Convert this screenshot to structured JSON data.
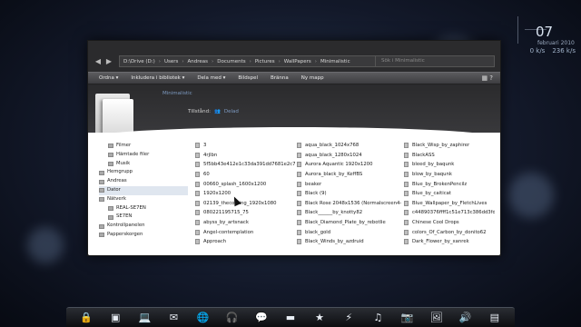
{
  "widgets": {
    "clock_day": "07",
    "clock_month": "februari 2010",
    "net_up": "0 k/s",
    "net_down": "236 k/s"
  },
  "window": {
    "address": [
      "D:\\Drive (D:)",
      "Users",
      "Andreas",
      "Documents",
      "Pictures",
      "WallPapers",
      "Minimalistic"
    ],
    "search_placeholder": "Sök i Minimalistic",
    "toolbar": [
      "Ordna ▾",
      "Inkludera i bibliotek ▾",
      "Dela med ▾",
      "Bildspel",
      "Bränna",
      "Ny mapp"
    ],
    "preview": {
      "name": "Minimalistic",
      "state_label": "Tillstånd:",
      "state_value": "Delad"
    },
    "nav": [
      "Filmer",
      "Hämtade filer",
      "Musik",
      "Hemgrupp",
      "Andreas",
      "Dator",
      "Nätverk",
      "REAL-SE7EN",
      "SE7EN",
      "Kontrollpanelen",
      "Papperskorgen"
    ],
    "files_col1": [
      "3",
      "4rjlbn",
      "5f5bb43e412e1c33da391dd7681e2c7",
      "60",
      "00660_splash_1600x1200",
      "1920x1200",
      "02139_thecoming_1920x1080",
      "080221195715_75",
      "abyss_by_artsnack",
      "Angel-contemplation",
      "Approach"
    ],
    "files_col2": [
      "aqua_black_1024x768",
      "aqua_black_1280x1024",
      "Aurora Aquantic 1920x1200",
      "Aurora_black_by_KeffBS",
      "beaker",
      "Black (9)",
      "Black Rose 2048x1536 (Normalscreen4-3)",
      "Black______by_knotty82",
      "Black_Diamond_Plate_by_rebotlie",
      "black_gold",
      "Black_Winds_by_azdruid"
    ],
    "files_col3": [
      "Black_Wisp_by_zaphirer",
      "BlackASS",
      "bleed_by_baqunk",
      "blow_by_baqunk",
      "Blue_by_BrokenPencilz",
      "Blue_by_caiticat",
      "Blue_Wallpaper_by_FletchLives",
      "c44890376ffff1c51e713c386dd3fde8",
      "Chinese Cool Drops",
      "colors_Of_Carbon_by_donito62",
      "Dark_Flower_by_xanrek"
    ]
  },
  "taskbar": [
    {
      "icon": "lock-icon",
      "glyph": "🔒"
    },
    {
      "icon": "drive-icon",
      "glyph": "▣"
    },
    {
      "icon": "laptop-icon",
      "glyph": "💻"
    },
    {
      "icon": "mail-icon",
      "glyph": "✉"
    },
    {
      "icon": "globe-icon",
      "glyph": "🌐"
    },
    {
      "icon": "headphones-icon",
      "glyph": "🎧"
    },
    {
      "icon": "chat-icon",
      "glyph": "💬"
    },
    {
      "icon": "video-icon",
      "glyph": "▬"
    },
    {
      "icon": "star-icon",
      "glyph": "★"
    },
    {
      "icon": "lightning-icon",
      "glyph": "⚡"
    },
    {
      "icon": "music-icon",
      "glyph": "♫"
    },
    {
      "icon": "camera-icon",
      "glyph": "📷"
    },
    {
      "icon": "image-icon",
      "glyph": "🖼"
    },
    {
      "icon": "volume-icon",
      "glyph": "🔊"
    },
    {
      "icon": "terminal-icon",
      "glyph": "▤"
    }
  ]
}
